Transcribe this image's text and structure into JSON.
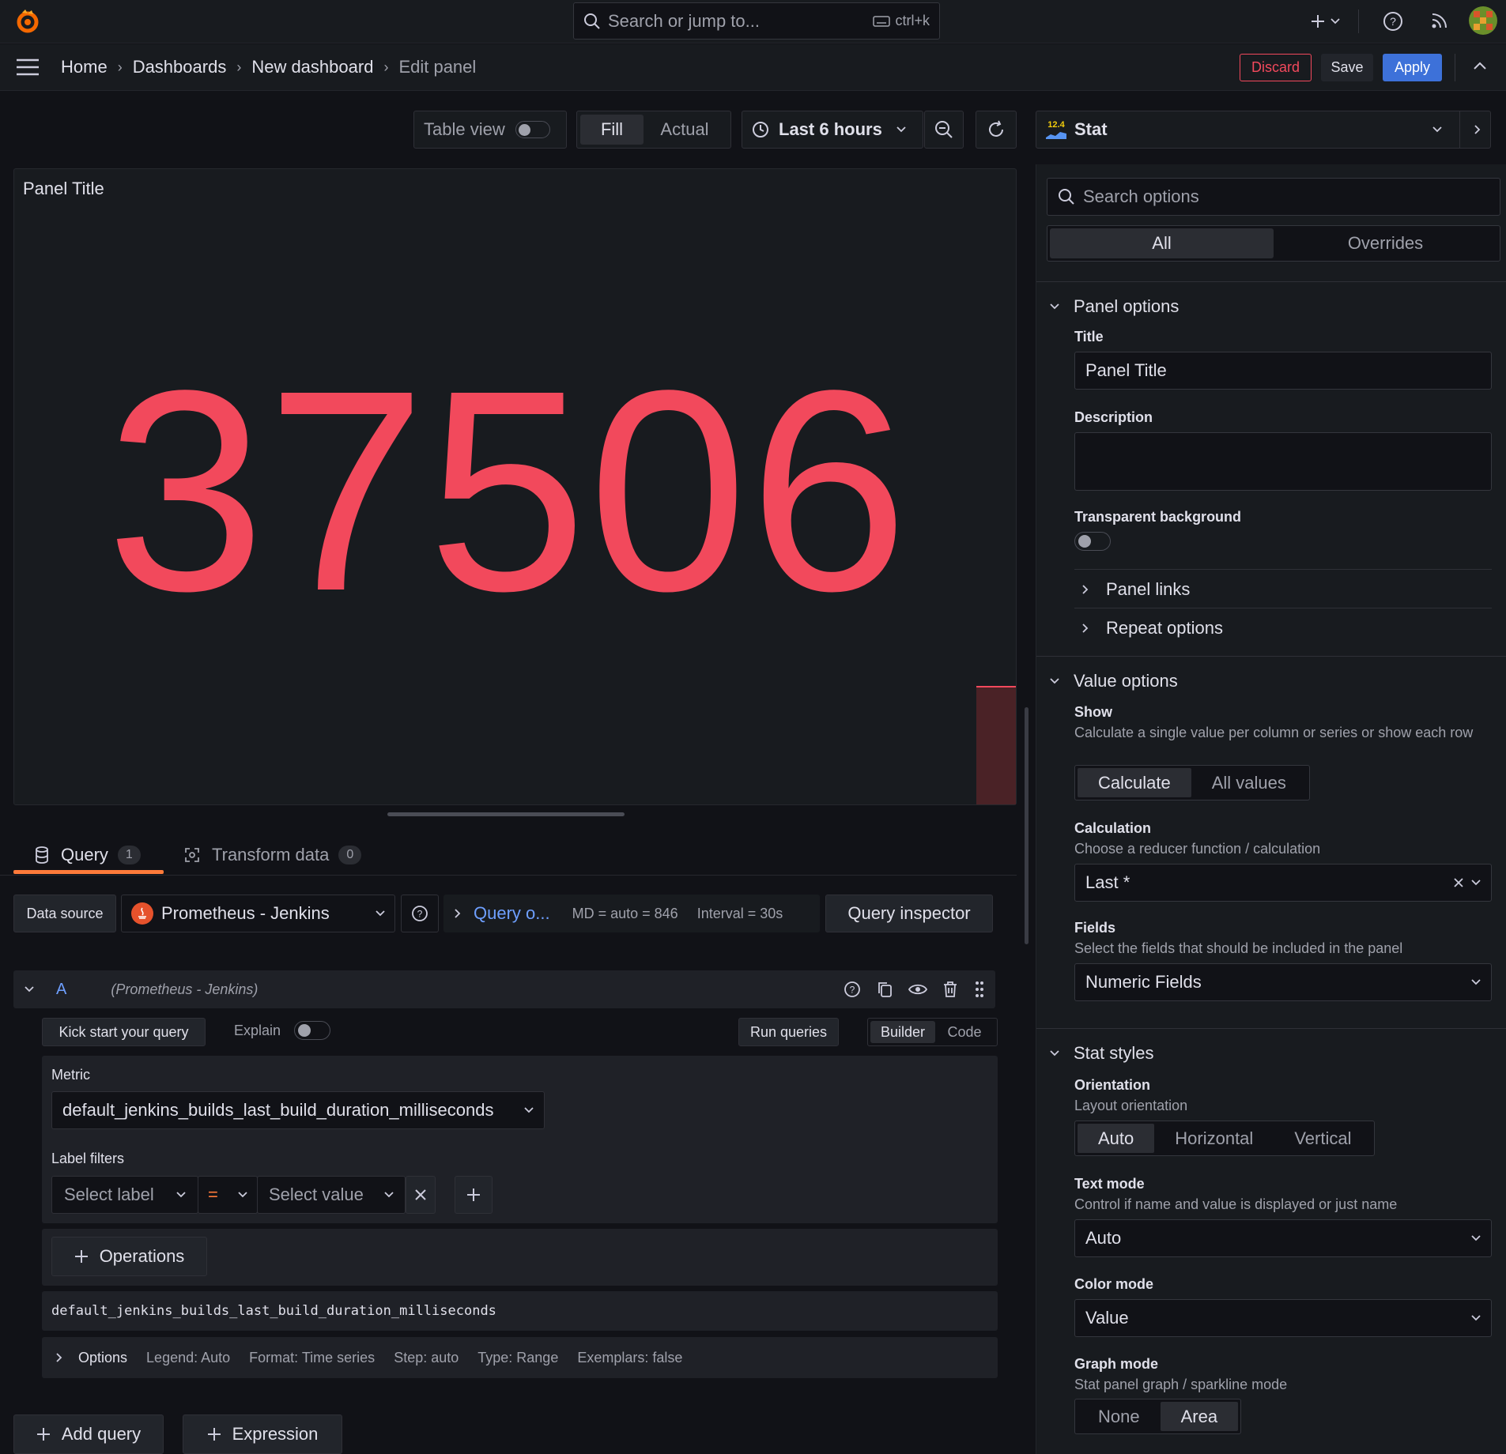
{
  "topbar": {
    "search_placeholder": "Search or jump to...",
    "shortcut": "ctrl+k"
  },
  "breadcrumb": {
    "items": [
      "Home",
      "Dashboards",
      "New dashboard"
    ],
    "current": "Edit panel"
  },
  "actions": {
    "discard": "Discard",
    "save": "Save",
    "apply": "Apply"
  },
  "toolbar": {
    "table_view": "Table view",
    "fill": "Fill",
    "actual": "Actual",
    "time_range": "Last 6 hours"
  },
  "viz": {
    "name": "Stat",
    "icon_label": "12.4"
  },
  "panel": {
    "title": "Panel Title",
    "value": "37506"
  },
  "tabs": {
    "query_label": "Query",
    "query_count": "1",
    "transform_label": "Transform data",
    "transform_count": "0"
  },
  "datasource": {
    "label": "Data source",
    "value": "Prometheus - Jenkins",
    "query_options": "Query o...",
    "md": "MD = auto = 846",
    "interval": "Interval = 30s",
    "inspector": "Query inspector"
  },
  "query": {
    "ref": "A",
    "ds": "(Prometheus - Jenkins)",
    "kickstart": "Kick start your query",
    "explain": "Explain",
    "run": "Run queries",
    "builder": "Builder",
    "code": "Code",
    "metric_label": "Metric",
    "metric": "default_jenkins_builds_last_build_duration_milliseconds",
    "label_filters": "Label filters",
    "select_label": "Select label",
    "op": "=",
    "select_value": "Select value",
    "operations": "Operations",
    "preview": "default_jenkins_builds_last_build_duration_milliseconds",
    "options_label": "Options",
    "opt_legend": "Legend: Auto",
    "opt_format": "Format: Time series",
    "opt_step": "Step: auto",
    "opt_type": "Type: Range",
    "opt_exemplars": "Exemplars: false"
  },
  "bottom": {
    "add_query": "Add query",
    "expression": "Expression"
  },
  "options": {
    "search_placeholder": "Search options",
    "tab_all": "All",
    "tab_overrides": "Overrides",
    "panel_options": "Panel options",
    "title_label": "Title",
    "title_value": "Panel Title",
    "description_label": "Description",
    "transparent_label": "Transparent background",
    "panel_links": "Panel links",
    "repeat_options": "Repeat options",
    "value_options": "Value options",
    "show_label": "Show",
    "show_desc": "Calculate a single value per column or series or show each row",
    "calculate": "Calculate",
    "all_values": "All values",
    "calculation_label": "Calculation",
    "calculation_desc": "Choose a reducer function / calculation",
    "calculation_value": "Last *",
    "fields_label": "Fields",
    "fields_desc": "Select the fields that should be included in the panel",
    "fields_value": "Numeric Fields",
    "stat_styles": "Stat styles",
    "orientation_label": "Orientation",
    "orientation_desc": "Layout orientation",
    "orient_auto": "Auto",
    "orient_horizontal": "Horizontal",
    "orient_vertical": "Vertical",
    "text_mode_label": "Text mode",
    "text_mode_desc": "Control if name and value is displayed or just name",
    "text_mode_value": "Auto",
    "color_mode_label": "Color mode",
    "color_mode_value": "Value",
    "graph_mode_label": "Graph mode",
    "graph_mode_desc": "Stat panel graph / sparkline mode",
    "graph_none": "None",
    "graph_area": "Area"
  },
  "colors": {
    "accent": "#3d71d9",
    "danger": "#f2495c",
    "value": "#f2495c",
    "tab_active": "#ff7a3a",
    "link": "#6e9fff"
  }
}
